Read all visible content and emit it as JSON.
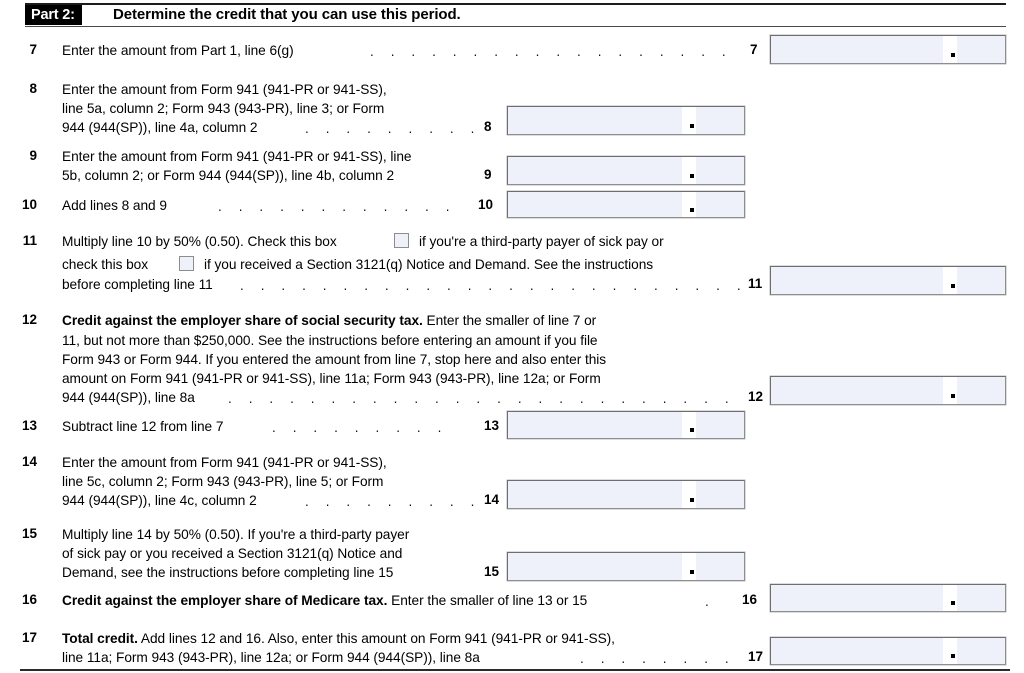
{
  "part": {
    "label": "Part 2:",
    "title": "Determine the credit that you can use this period."
  },
  "lines": [
    {
      "number": "7",
      "box_number": "7",
      "text": "Enter the amount from Part 1, line 6(g)",
      "leaders": ". . . . . . . . . . . . . . . . . ."
    },
    {
      "number": "8",
      "box_number": "8",
      "text_line1": "Enter the amount from Form 941 (941-PR or 941-SS),",
      "text_line2": "line 5a, column 2; Form 943 (943-PR), line 3; or Form",
      "text_line3": "944 (944(SP)), line 4a, column 2",
      "leaders": ". . . . . . . . ."
    },
    {
      "number": "9",
      "box_number": "9",
      "text_line1": "Enter the amount from Form 941 (941-PR or 941-SS), line",
      "text_line2": "5b, column 2; or Form 944 (944(SP)), line 4b, column 2"
    },
    {
      "number": "10",
      "box_number": "10",
      "text": "Add lines 8 and 9",
      "leaders": ". . . . . . . . . . . ."
    },
    {
      "number": "11",
      "box_number": "11",
      "text_a": "Multiply line 10 by 50% (0.50). Check this box",
      "text_b": "if you're a third-party payer of sick pay or",
      "text_c": "check this box",
      "text_d": "if you received a Section 3121(q) Notice and Demand. See the instructions",
      "text_e": "before completing line 11",
      "leaders": ". . . . . . . . . . . . . . . . . . . . . . . . . .",
      "checkbox1": "third-party-payer-checkbox",
      "checkbox2": "section-3121q-notice-checkbox"
    },
    {
      "number": "12",
      "box_number": "12",
      "bold_lead": "Credit against the employer share of social security tax.",
      "text_line1_rest": " Enter the smaller of line 7 or",
      "text_line2": "11, but not more than $250,000. See the instructions before entering an amount if you file",
      "text_line3": "Form 943 or Form 944. If you entered the amount from line 7, stop here and also enter this",
      "text_line4": "amount on Form 941 (941-PR or 941-SS), line 11a; Form 943 (943-PR), line 12a; or Form",
      "text_line5": "944 (944(SP)), line 8a",
      "leaders": ". . . . . . . . . . . . . . . . . . . . . . . . . ."
    },
    {
      "number": "13",
      "box_number": "13",
      "text": "Subtract line 12 from line 7",
      "leaders": ". . . . . . . . ."
    },
    {
      "number": "14",
      "box_number": "14",
      "text_line1": "Enter the amount from Form 941 (941-PR or 941-SS),",
      "text_line2": "line 5c, column 2; Form 943 (943-PR), line 5; or Form",
      "text_line3": "944 (944(SP)), line 4c, column 2",
      "leaders": ". . . . . . . . ."
    },
    {
      "number": "15",
      "box_number": "15",
      "text_line1": "Multiply line 14 by 50% (0.50). If you're a third-party payer",
      "text_line2": "of sick pay or you received a Section 3121(q) Notice and",
      "text_line3": "Demand, see the instructions before completing line 15"
    },
    {
      "number": "16",
      "box_number": "16",
      "bold_lead": "Credit against the employer share of Medicare tax.",
      "text_rest": " Enter the smaller of line 13 or 15",
      "leaders": "."
    },
    {
      "number": "17",
      "box_number": "17",
      "bold_lead": "Total credit.",
      "text_line1_rest": " Add lines 12 and 16. Also, enter this amount on Form 941 (941-PR or 941-SS),",
      "text_line2": "line 11a; Form 943 (943-PR), line 12a; or Form 944 (944(SP)), line 8a",
      "leaders": ". . . . . . . ."
    }
  ],
  "colors": {
    "box_fill": "#eef1fa",
    "box_border": "#8e8e90",
    "header_bar": "#000000",
    "rule": "#1c1c1c"
  }
}
